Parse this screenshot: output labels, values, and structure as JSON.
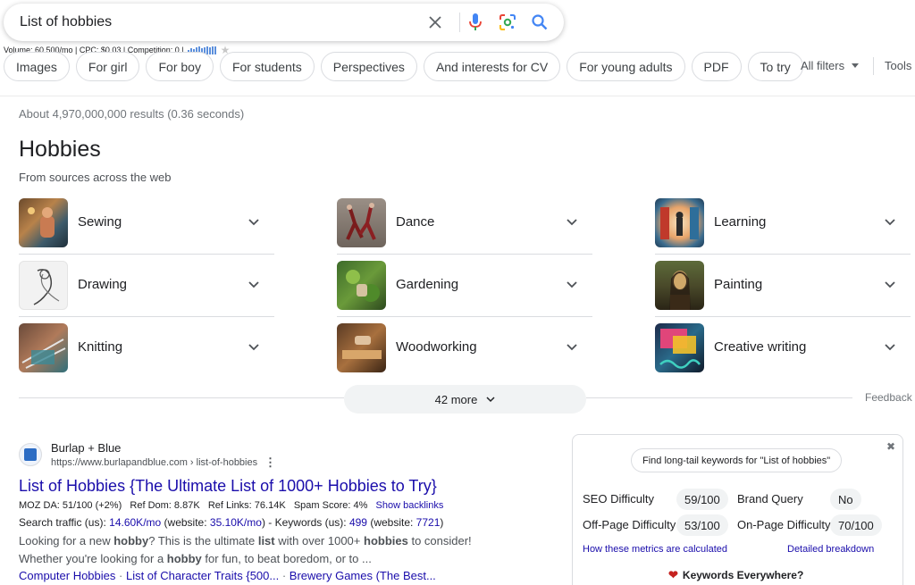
{
  "search": {
    "query": "List of hobbies",
    "icons": [
      "close-icon",
      "mic-icon",
      "lens-icon",
      "search-icon"
    ]
  },
  "metrics_line": "Volume: 60,500/mo | CPC: $0.03 | Competition: 0 |",
  "chips": [
    "Images",
    "For girl",
    "For boy",
    "For students",
    "Perspectives",
    "And interests for CV",
    "For young adults",
    "PDF",
    "To try"
  ],
  "toolbar": {
    "all_filters": "All filters",
    "tools": "Tools"
  },
  "results_stats": "About 4,970,000,000 results (0.36 seconds)",
  "hobbies": {
    "title": "Hobbies",
    "subtitle": "From sources across the web",
    "items": [
      {
        "label": "Sewing",
        "thumb": "sewing"
      },
      {
        "label": "Dance",
        "thumb": "dance"
      },
      {
        "label": "Learning",
        "thumb": "learning"
      },
      {
        "label": "Drawing",
        "thumb": "drawing"
      },
      {
        "label": "Gardening",
        "thumb": "gardening"
      },
      {
        "label": "Painting",
        "thumb": "painting"
      },
      {
        "label": "Knitting",
        "thumb": "knitting"
      },
      {
        "label": "Woodworking",
        "thumb": "woodworking"
      },
      {
        "label": "Creative writing",
        "thumb": "creative-writing"
      }
    ],
    "more_label": "42 more",
    "feedback": "Feedback"
  },
  "result": {
    "site_name": "Burlap + Blue",
    "url": "https://www.burlapandblue.com › list-of-hobbies",
    "title": "List of Hobbies {The Ultimate List of 1000+ Hobbies to Try}",
    "moz_text": "MOZ DA: 51/100 (+2%)   Ref Dom: 8.87K   Ref Links: 76.14K   Spam Score: 4%",
    "show_backlinks": "Show backlinks",
    "traffic": {
      "prefix": "Search traffic (us): ",
      "value1": "14.60K/mo",
      "mid1": " (website: ",
      "value2": "35.10K/mo",
      "mid2": ") - Keywords (us): ",
      "value3": "499",
      "mid3": " (website: ",
      "value4": "7721",
      "suffix": ")"
    },
    "snippet1": {
      "a": "Looking for a new ",
      "b": "hobby",
      "c": "? This is the ultimate ",
      "d": "list",
      "e": " with over 1000+ ",
      "f": "hobbies",
      "g": " to consider!"
    },
    "snippet2": {
      "a": "Whether you're looking for a ",
      "b": "hobby",
      "c": " for fun, to beat boredom, or to ..."
    },
    "sitelinks": [
      "Computer Hobbies",
      "List of Character Traits {500...",
      "Brewery Games (The Best..."
    ]
  },
  "widget": {
    "find_button": "Find long-tail keywords for \"List of hobbies\"",
    "seo_label": "SEO Difficulty",
    "seo_value": "59/100",
    "brand_label": "Brand Query",
    "brand_value": "No",
    "offpage_label": "Off-Page Difficulty",
    "offpage_value": "53/100",
    "onpage_label": "On-Page Difficulty",
    "onpage_value": "70/100",
    "how_link": "How these metrics are calculated",
    "detail_link": "Detailed breakdown",
    "brand_footer": "Keywords Everywhere?"
  }
}
